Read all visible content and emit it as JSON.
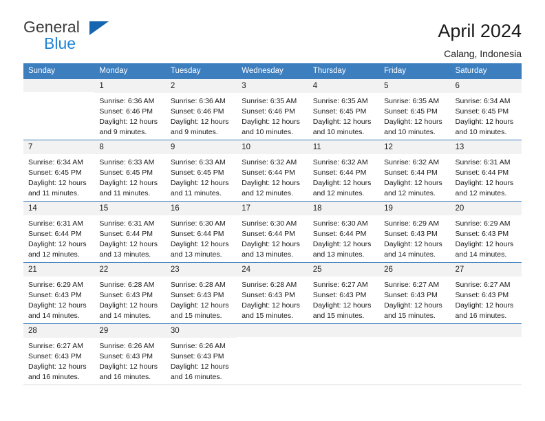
{
  "brand": {
    "name_part1": "General",
    "name_part2": "Blue",
    "triangle_color": "#1565b0",
    "blue_color": "#1f84d6"
  },
  "header": {
    "title": "April 2024",
    "subtitle": "Calang, Indonesia"
  },
  "theme": {
    "header_row_bg": "#3d7ebf",
    "daynum_bg": "#f2f2f2",
    "separator": "#3d7ebf",
    "text": "#1a1a1a"
  },
  "weekday_headers": [
    "Sunday",
    "Monday",
    "Tuesday",
    "Wednesday",
    "Thursday",
    "Friday",
    "Saturday"
  ],
  "labels": {
    "sunrise_prefix": "Sunrise:",
    "sunset_prefix": "Sunset:",
    "daylight_prefix": "Daylight:"
  },
  "weeks": [
    [
      {
        "day": "",
        "empty": true,
        "line1": "",
        "line2": "",
        "line3": "",
        "line4": ""
      },
      {
        "day": "1",
        "empty": false,
        "line1": "Sunrise: 6:36 AM",
        "line2": "Sunset: 6:46 PM",
        "line3": "Daylight: 12 hours",
        "line4": "and 9 minutes."
      },
      {
        "day": "2",
        "empty": false,
        "line1": "Sunrise: 6:36 AM",
        "line2": "Sunset: 6:46 PM",
        "line3": "Daylight: 12 hours",
        "line4": "and 9 minutes."
      },
      {
        "day": "3",
        "empty": false,
        "line1": "Sunrise: 6:35 AM",
        "line2": "Sunset: 6:46 PM",
        "line3": "Daylight: 12 hours",
        "line4": "and 10 minutes."
      },
      {
        "day": "4",
        "empty": false,
        "line1": "Sunrise: 6:35 AM",
        "line2": "Sunset: 6:45 PM",
        "line3": "Daylight: 12 hours",
        "line4": "and 10 minutes."
      },
      {
        "day": "5",
        "empty": false,
        "line1": "Sunrise: 6:35 AM",
        "line2": "Sunset: 6:45 PM",
        "line3": "Daylight: 12 hours",
        "line4": "and 10 minutes."
      },
      {
        "day": "6",
        "empty": false,
        "line1": "Sunrise: 6:34 AM",
        "line2": "Sunset: 6:45 PM",
        "line3": "Daylight: 12 hours",
        "line4": "and 10 minutes."
      }
    ],
    [
      {
        "day": "7",
        "empty": false,
        "line1": "Sunrise: 6:34 AM",
        "line2": "Sunset: 6:45 PM",
        "line3": "Daylight: 12 hours",
        "line4": "and 11 minutes."
      },
      {
        "day": "8",
        "empty": false,
        "line1": "Sunrise: 6:33 AM",
        "line2": "Sunset: 6:45 PM",
        "line3": "Daylight: 12 hours",
        "line4": "and 11 minutes."
      },
      {
        "day": "9",
        "empty": false,
        "line1": "Sunrise: 6:33 AM",
        "line2": "Sunset: 6:45 PM",
        "line3": "Daylight: 12 hours",
        "line4": "and 11 minutes."
      },
      {
        "day": "10",
        "empty": false,
        "line1": "Sunrise: 6:32 AM",
        "line2": "Sunset: 6:44 PM",
        "line3": "Daylight: 12 hours",
        "line4": "and 12 minutes."
      },
      {
        "day": "11",
        "empty": false,
        "line1": "Sunrise: 6:32 AM",
        "line2": "Sunset: 6:44 PM",
        "line3": "Daylight: 12 hours",
        "line4": "and 12 minutes."
      },
      {
        "day": "12",
        "empty": false,
        "line1": "Sunrise: 6:32 AM",
        "line2": "Sunset: 6:44 PM",
        "line3": "Daylight: 12 hours",
        "line4": "and 12 minutes."
      },
      {
        "day": "13",
        "empty": false,
        "line1": "Sunrise: 6:31 AM",
        "line2": "Sunset: 6:44 PM",
        "line3": "Daylight: 12 hours",
        "line4": "and 12 minutes."
      }
    ],
    [
      {
        "day": "14",
        "empty": false,
        "line1": "Sunrise: 6:31 AM",
        "line2": "Sunset: 6:44 PM",
        "line3": "Daylight: 12 hours",
        "line4": "and 12 minutes."
      },
      {
        "day": "15",
        "empty": false,
        "line1": "Sunrise: 6:31 AM",
        "line2": "Sunset: 6:44 PM",
        "line3": "Daylight: 12 hours",
        "line4": "and 13 minutes."
      },
      {
        "day": "16",
        "empty": false,
        "line1": "Sunrise: 6:30 AM",
        "line2": "Sunset: 6:44 PM",
        "line3": "Daylight: 12 hours",
        "line4": "and 13 minutes."
      },
      {
        "day": "17",
        "empty": false,
        "line1": "Sunrise: 6:30 AM",
        "line2": "Sunset: 6:44 PM",
        "line3": "Daylight: 12 hours",
        "line4": "and 13 minutes."
      },
      {
        "day": "18",
        "empty": false,
        "line1": "Sunrise: 6:30 AM",
        "line2": "Sunset: 6:44 PM",
        "line3": "Daylight: 12 hours",
        "line4": "and 13 minutes."
      },
      {
        "day": "19",
        "empty": false,
        "line1": "Sunrise: 6:29 AM",
        "line2": "Sunset: 6:43 PM",
        "line3": "Daylight: 12 hours",
        "line4": "and 14 minutes."
      },
      {
        "day": "20",
        "empty": false,
        "line1": "Sunrise: 6:29 AM",
        "line2": "Sunset: 6:43 PM",
        "line3": "Daylight: 12 hours",
        "line4": "and 14 minutes."
      }
    ],
    [
      {
        "day": "21",
        "empty": false,
        "line1": "Sunrise: 6:29 AM",
        "line2": "Sunset: 6:43 PM",
        "line3": "Daylight: 12 hours",
        "line4": "and 14 minutes."
      },
      {
        "day": "22",
        "empty": false,
        "line1": "Sunrise: 6:28 AM",
        "line2": "Sunset: 6:43 PM",
        "line3": "Daylight: 12 hours",
        "line4": "and 14 minutes."
      },
      {
        "day": "23",
        "empty": false,
        "line1": "Sunrise: 6:28 AM",
        "line2": "Sunset: 6:43 PM",
        "line3": "Daylight: 12 hours",
        "line4": "and 15 minutes."
      },
      {
        "day": "24",
        "empty": false,
        "line1": "Sunrise: 6:28 AM",
        "line2": "Sunset: 6:43 PM",
        "line3": "Daylight: 12 hours",
        "line4": "and 15 minutes."
      },
      {
        "day": "25",
        "empty": false,
        "line1": "Sunrise: 6:27 AM",
        "line2": "Sunset: 6:43 PM",
        "line3": "Daylight: 12 hours",
        "line4": "and 15 minutes."
      },
      {
        "day": "26",
        "empty": false,
        "line1": "Sunrise: 6:27 AM",
        "line2": "Sunset: 6:43 PM",
        "line3": "Daylight: 12 hours",
        "line4": "and 15 minutes."
      },
      {
        "day": "27",
        "empty": false,
        "line1": "Sunrise: 6:27 AM",
        "line2": "Sunset: 6:43 PM",
        "line3": "Daylight: 12 hours",
        "line4": "and 16 minutes."
      }
    ],
    [
      {
        "day": "28",
        "empty": false,
        "line1": "Sunrise: 6:27 AM",
        "line2": "Sunset: 6:43 PM",
        "line3": "Daylight: 12 hours",
        "line4": "and 16 minutes."
      },
      {
        "day": "29",
        "empty": false,
        "line1": "Sunrise: 6:26 AM",
        "line2": "Sunset: 6:43 PM",
        "line3": "Daylight: 12 hours",
        "line4": "and 16 minutes."
      },
      {
        "day": "30",
        "empty": false,
        "line1": "Sunrise: 6:26 AM",
        "line2": "Sunset: 6:43 PM",
        "line3": "Daylight: 12 hours",
        "line4": "and 16 minutes."
      },
      {
        "day": "",
        "empty": true,
        "line1": "",
        "line2": "",
        "line3": "",
        "line4": ""
      },
      {
        "day": "",
        "empty": true,
        "line1": "",
        "line2": "",
        "line3": "",
        "line4": ""
      },
      {
        "day": "",
        "empty": true,
        "line1": "",
        "line2": "",
        "line3": "",
        "line4": ""
      },
      {
        "day": "",
        "empty": true,
        "line1": "",
        "line2": "",
        "line3": "",
        "line4": ""
      }
    ]
  ]
}
